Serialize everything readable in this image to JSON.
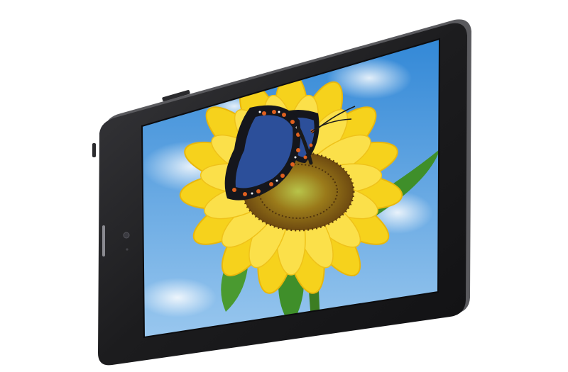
{
  "scene": {
    "subject": "tablet",
    "screen_content": "butterfly-on-sunflower",
    "colors": {
      "background": "#ffffff",
      "device_body": "#1c1c1e",
      "device_edge": "#4a4a4e",
      "sky_top": "#2f86d6",
      "sky_bottom": "#9cc9ef",
      "petal": "#f6d21c",
      "petal_shade": "#e9b70c",
      "seed_head": "#7a5412",
      "leaf": "#3f8f2a",
      "wing_blue": "#2c4f9a",
      "wing_black": "#15161c",
      "wing_orange": "#e0601f"
    }
  }
}
